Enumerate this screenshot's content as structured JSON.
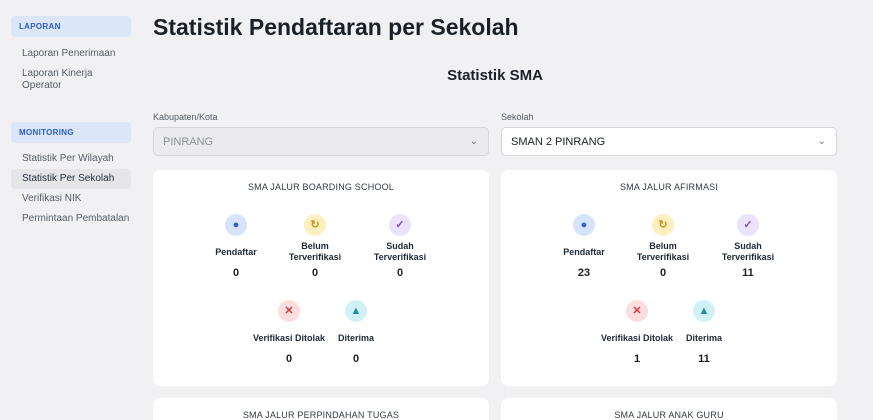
{
  "sidebar": {
    "sections": [
      {
        "title": "LAPORAN",
        "items": [
          "Laporan Penerimaan",
          "Laporan Kinerja Operator"
        ]
      },
      {
        "title": "MONITORING",
        "items": [
          "Statistik Per Wilayah",
          "Statistik Per Sekolah",
          "Verifikasi NIK",
          "Permintaan Pembatalan"
        ]
      }
    ],
    "active_item": "Statistik Per Sekolah"
  },
  "main": {
    "title": "Statistik Pendaftaran per Sekolah",
    "subtitle": "Statistik SMA",
    "filters": {
      "kabupaten": {
        "label": "Kabupaten/Kota",
        "value": "PINRANG"
      },
      "sekolah": {
        "label": "Sekolah",
        "value": "SMAN 2 PINRANG"
      }
    },
    "cards": [
      {
        "title": "SMA JALUR BOARDING SCHOOL",
        "stats": {
          "pendaftar": {
            "label": "Pendaftar",
            "value": "0"
          },
          "belum": {
            "label": "Belum Terverifikasi",
            "value": "0"
          },
          "sudah": {
            "label": "Sudah Terverifikasi",
            "value": "0"
          },
          "ditolak": {
            "label": "Verifikasi Ditolak",
            "value": "0"
          },
          "diterima": {
            "label": "Diterima",
            "value": "0"
          }
        }
      },
      {
        "title": "SMA JALUR AFIRMASI",
        "stats": {
          "pendaftar": {
            "label": "Pendaftar",
            "value": "23"
          },
          "belum": {
            "label": "Belum Terverifikasi",
            "value": "0"
          },
          "sudah": {
            "label": "Sudah Terverifikasi",
            "value": "11"
          },
          "ditolak": {
            "label": "Verifikasi Ditolak",
            "value": "1"
          },
          "diterima": {
            "label": "Diterima",
            "value": "11"
          }
        }
      },
      {
        "title": "SMA JALUR PERPINDAHAN TUGAS"
      },
      {
        "title": "SMA JALUR ANAK GURU"
      }
    ]
  },
  "icons": {
    "pendaftar": "person-icon",
    "belum": "refresh-icon",
    "sudah": "check-icon",
    "ditolak": "x-icon",
    "diterima": "graduation-cap-icon"
  },
  "colors": {
    "accent": "#2b5bc6",
    "section_bg": "#dbe6f9",
    "blue": "#2f5fd0",
    "yellow": "#c9951a",
    "purple": "#7c4fd6",
    "red": "#d33b3b",
    "teal": "#1d8ba6"
  }
}
